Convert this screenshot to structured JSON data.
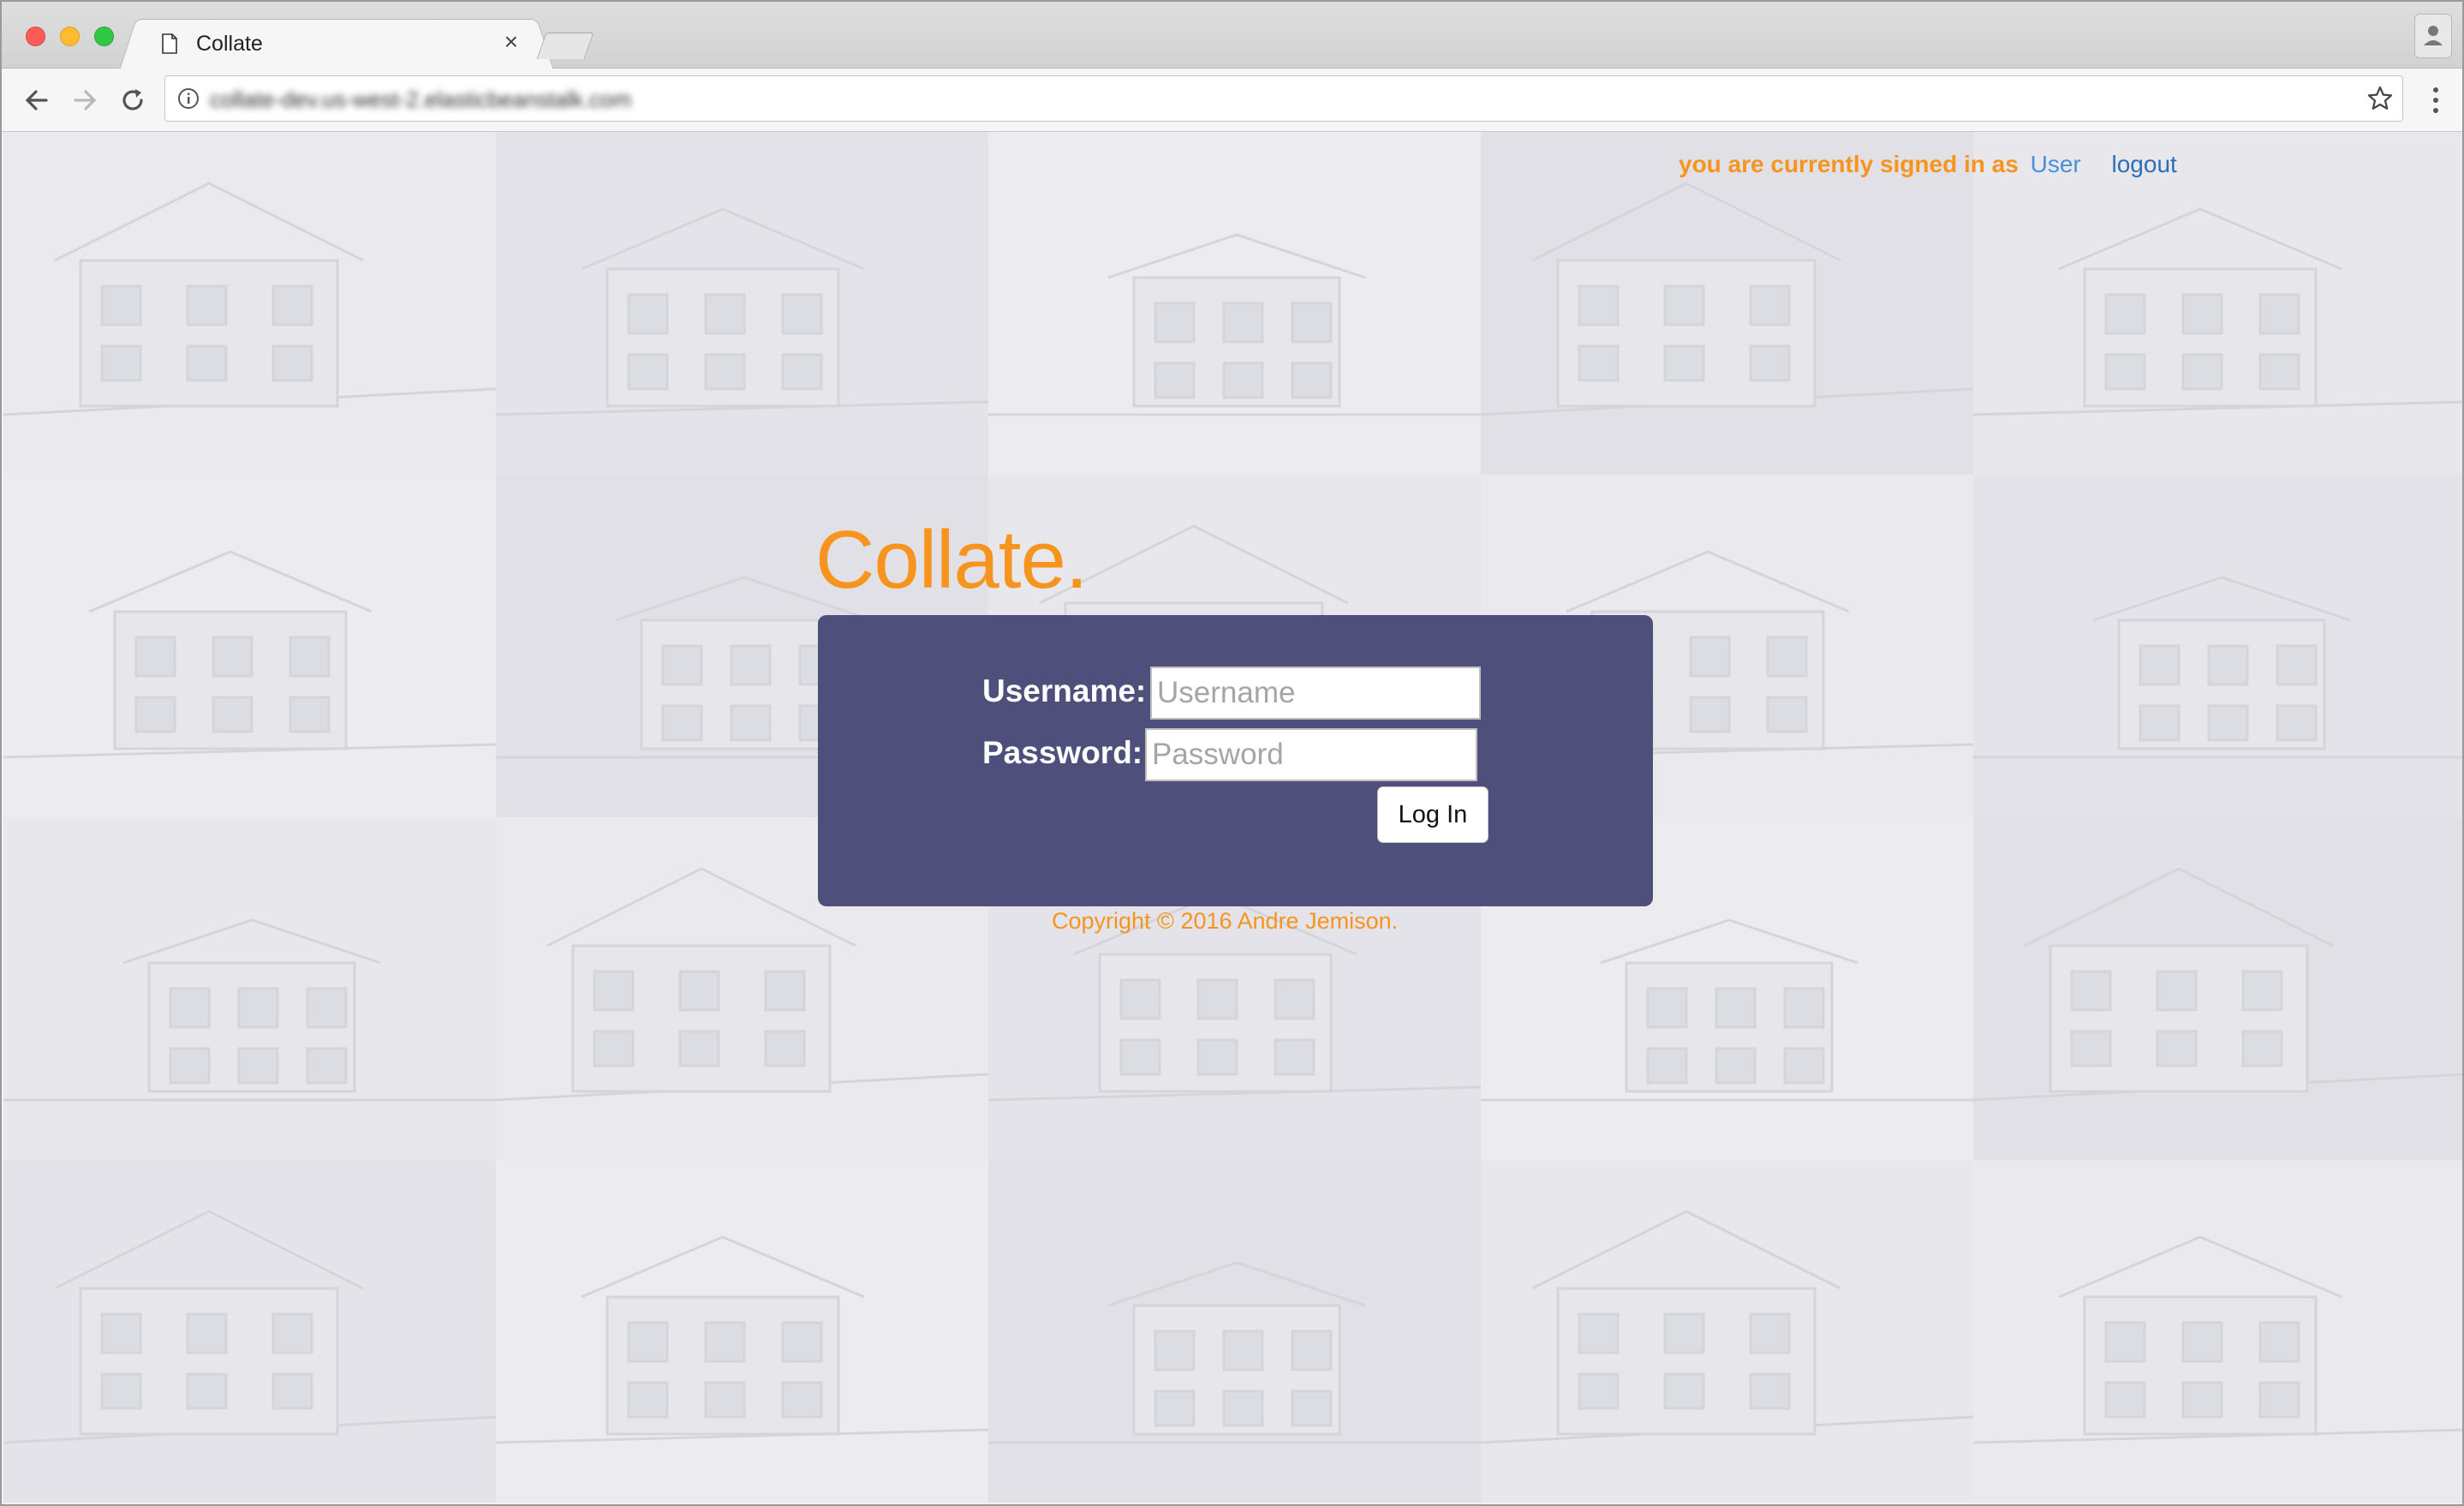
{
  "browser": {
    "tab_title": "Collate",
    "tab_close": "×",
    "url": "collate-dev.us-west-2.elasticbeanstalk.com"
  },
  "header": {
    "signed_in_text": "you are currently signed in as",
    "user_link": "User",
    "logout_link": "logout"
  },
  "brand": {
    "title": "Collate."
  },
  "login_form": {
    "username_label": "Username:",
    "username_placeholder": "Username",
    "username_value": "",
    "password_label": "Password:",
    "password_placeholder": "Password",
    "password_value": "",
    "submit_label": "Log In"
  },
  "footer": {
    "copyright": "Copyright © 2016 Andre Jemison."
  },
  "colors": {
    "accent_orange": "#f7941d",
    "panel_purple": "#4f4f7b",
    "link_blue": "#4a90d9",
    "page_background": "#f1f1f4"
  },
  "icons": {
    "tab": "page-icon",
    "back": "back-arrow-icon",
    "forward": "forward-arrow-icon",
    "reload": "reload-icon",
    "info": "info-icon",
    "bookmark": "star-icon",
    "menu": "menu-dots-icon",
    "profile": "person-icon"
  }
}
